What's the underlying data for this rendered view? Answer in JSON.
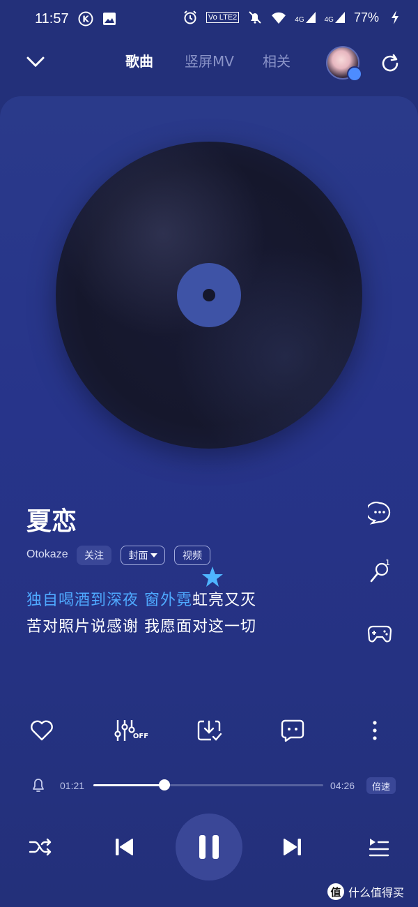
{
  "status": {
    "time": "11:57",
    "volte_label": "Vo LTE2",
    "net1": "4G",
    "net2": "4G",
    "battery": "77%"
  },
  "header": {
    "tabs": [
      {
        "label": "歌曲",
        "active": true
      },
      {
        "label": "竖屏MV",
        "active": false
      },
      {
        "label": "相关",
        "active": false
      }
    ]
  },
  "song": {
    "title": "夏恋",
    "artist": "Otokaze",
    "follow_label": "关注",
    "cover_label": "封面",
    "video_label": "视频"
  },
  "lyrics": {
    "line1_sung": "独自喝酒到深夜 窗外霓",
    "line1_rest": "虹亮又灭",
    "line2": "苦对照片说感谢 我愿面对这一切"
  },
  "side_icons": {
    "mic_count": "1"
  },
  "actions": {
    "effect_off_label": "OFF"
  },
  "progress": {
    "current": "01:21",
    "total": "04:26",
    "fraction": 0.31,
    "speed_label": "倍速"
  },
  "watermark": {
    "logo": "值",
    "text": "什么值得买"
  },
  "colors": {
    "background": "#23307a",
    "accent": "#4fa9ff"
  }
}
